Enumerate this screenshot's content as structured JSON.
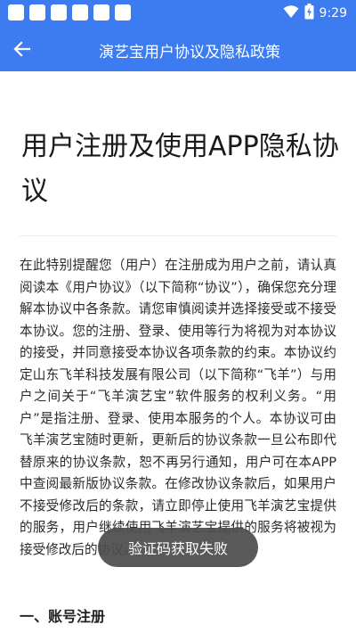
{
  "status_bar": {
    "time": "9:29",
    "notification_icons": [
      "notification-icon",
      "notification-icon",
      "notification-icon",
      "notification-icon",
      "notification-icon",
      "notification-icon"
    ],
    "icons": [
      "wifi-icon",
      "battery-charging-icon"
    ]
  },
  "app_bar": {
    "back_icon": "arrow-left-icon",
    "title": "演艺宝用户协议及隐私政策",
    "background": "#3d7cf0"
  },
  "document": {
    "title": "用户注册及使用APP隐私协议",
    "body": "在此特别提醒您（用户）在注册成为用户之前，请认真阅读本《用户协议》（以下简称“协议”），确保您充分理解本协议中各条款。请您审慎阅读并选择接受或不接受本协议。您的注册、登录、使用等行为将视为对本协议的接受，并同意接受本协议各项条款的约束。本协议约定山东飞羊科技发展有限公司（以下简称“飞羊”）与用户之间关于“飞羊演艺宝”软件服务的权利义务。“用户”是指注册、登录、使用本服务的个人。本协议可由飞羊演艺宝随时更新，更新后的协议条款一旦公布即代替原来的协议条款，恕不再另行通知，用户可在本APP中查阅最新版协议条款。在修改协议条款后，如果用户不接受修改后的条款，请立即停止使用飞羊演艺宝提供的服务，用户继续使用飞羊演艺宝提供的服务将被视为接受修改后的协议。",
    "section_1": "一、账号注册"
  },
  "toast": {
    "message": "验证码获取失败"
  }
}
